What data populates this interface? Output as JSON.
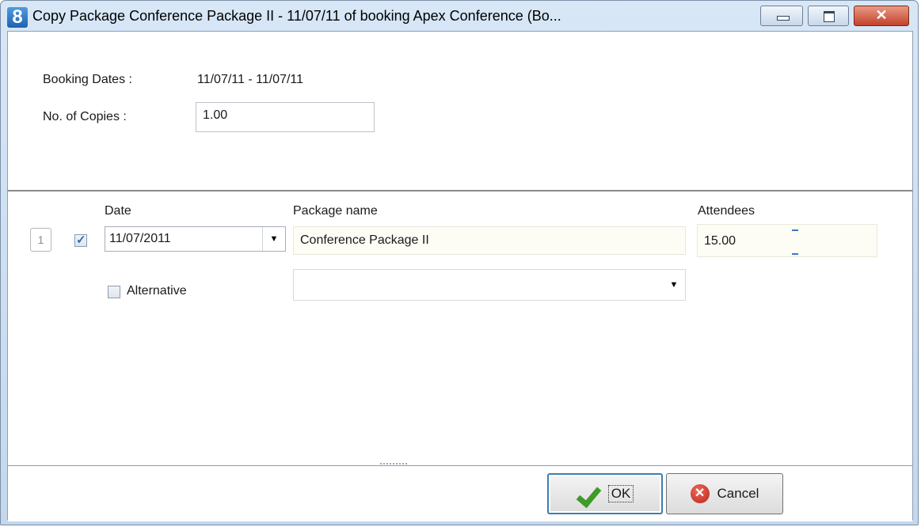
{
  "window": {
    "title": "Copy Package Conference Package II - 11/07/11 of booking Apex Conference (Bo...",
    "app_icon_glyph": "8",
    "controls": {
      "minimize": "minimize",
      "maximize": "maximize",
      "close": "✕"
    }
  },
  "header": {
    "booking_dates_label": "Booking Dates :",
    "booking_dates_value": "11/07/11 - 11/07/11",
    "copies_label": "No. of Copies :",
    "copies_value": "1.00"
  },
  "columns": {
    "date": "Date",
    "package_name": "Package name",
    "attendees": "Attendees"
  },
  "rows": [
    {
      "number": "1",
      "checked": true,
      "date": "11/07/2011",
      "package_name": "Conference Package II",
      "attendees": "15.00",
      "alternative_label": "Alternative",
      "alternative_checked": false,
      "alternative_value": ""
    }
  ],
  "buttons": {
    "ok_label": "OK",
    "ok_accesskey": "O",
    "cancel_label": "Cancel",
    "cancel_accesskey": "C"
  },
  "icons": {
    "ok": "green-checkmark-icon",
    "cancel": "red-x-circle-icon"
  }
}
